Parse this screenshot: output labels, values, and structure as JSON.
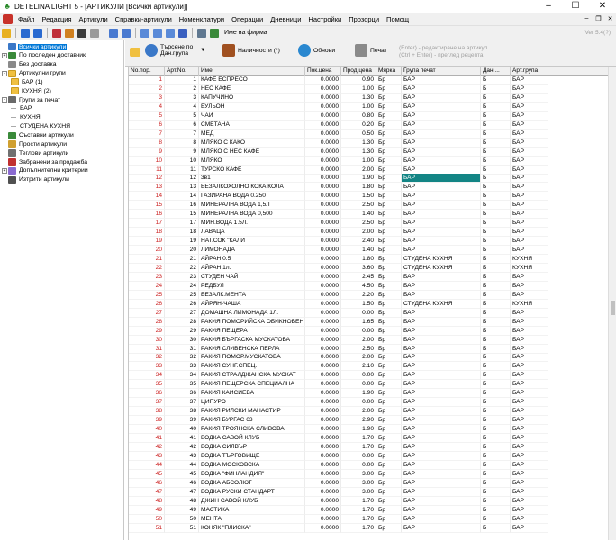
{
  "window": {
    "title": "DETELINA LIGHT 5 - [АРТИКУЛИ [Всички артикули]]"
  },
  "menu": [
    "Файл",
    "Редакция",
    "Артикули",
    "Справки-артикули",
    "Номенклатури",
    "Операции",
    "Дневници",
    "Настройки",
    "Прозорци",
    "Помощ"
  ],
  "toolbar": {
    "firm_label": "Име на фирма",
    "version": "Ver 5.4(?)"
  },
  "tree": [
    {
      "label": "Всички артикули",
      "level": 0,
      "selected": true,
      "icon": "articles-icon",
      "exp": ""
    },
    {
      "label": "По последен доставчик",
      "level": 0,
      "icon": "suppliers-icon",
      "exp": "+"
    },
    {
      "label": "Без доставка",
      "level": 0,
      "icon": "no-delivery-icon",
      "exp": ""
    },
    {
      "label": "Артикулни групи",
      "level": 0,
      "icon": "folder-icon",
      "exp": "-"
    },
    {
      "label": "БАР (1)",
      "level": 1,
      "icon": "folder-icon",
      "exp": ""
    },
    {
      "label": "КУХНЯ (2)",
      "level": 1,
      "icon": "folder-icon",
      "exp": ""
    },
    {
      "label": "Групи за печат",
      "level": 0,
      "icon": "print-groups-icon",
      "exp": "-"
    },
    {
      "label": "БАР",
      "level": 1,
      "icon": "",
      "exp": ""
    },
    {
      "label": "КУХНЯ",
      "level": 1,
      "icon": "",
      "exp": ""
    },
    {
      "label": "СТУДЕНА КУХНЯ",
      "level": 1,
      "icon": "",
      "exp": ""
    },
    {
      "label": "Съставни артикули",
      "level": 0,
      "icon": "composite-icon",
      "exp": ""
    },
    {
      "label": "Прости артикули",
      "level": 0,
      "icon": "simple-icon",
      "exp": ""
    },
    {
      "label": "Теглови артикули",
      "level": 0,
      "icon": "weight-icon",
      "exp": ""
    },
    {
      "label": "Забранени за продажба",
      "level": 0,
      "icon": "forbidden-icon",
      "exp": ""
    },
    {
      "label": "Допълнителни критерии",
      "level": 0,
      "icon": "criteria-icon",
      "exp": "+"
    },
    {
      "label": "Изтрити артикули",
      "level": 0,
      "icon": "trash-icon",
      "exp": ""
    }
  ],
  "actions": {
    "search_group": "Търсене по\nДан.група",
    "availability": "Наличности (*)",
    "refresh": "Обнови",
    "print": "Печат",
    "hint": "(Enter) - редактиране на артикул\n(Ctrl + Enter) - преглед рецепта"
  },
  "columns": [
    "No.пор.",
    "Арт.No.",
    "Име",
    "Пок.цена",
    "Прод.цена",
    "Мярка",
    "Група печат",
    "Дан....",
    "Арт.група"
  ],
  "rows": [
    [
      "1",
      "1",
      "КАФЕ ЕСПРЕСО",
      "0.0000",
      "0.90",
      "Бр",
      "БАР",
      "Б",
      "БАР"
    ],
    [
      "2",
      "2",
      "НЕС КАФЕ",
      "0.0000",
      "1.00",
      "Бр",
      "БАР",
      "Б",
      "БАР"
    ],
    [
      "3",
      "3",
      "КАПУЧИНО",
      "0.0000",
      "1.30",
      "Бр",
      "БАР",
      "Б",
      "БАР"
    ],
    [
      "4",
      "4",
      "БУЛЬОН",
      "0.0000",
      "1.00",
      "Бр",
      "БАР",
      "Б",
      "БАР"
    ],
    [
      "5",
      "5",
      "ЧАЙ",
      "0.0000",
      "0.80",
      "Бр",
      "БАР",
      "Б",
      "БАР"
    ],
    [
      "6",
      "6",
      "СМЕТАНА",
      "0.0000",
      "0.20",
      "Бр",
      "БАР",
      "Б",
      "БАР"
    ],
    [
      "7",
      "7",
      "МЕД",
      "0.0000",
      "0.50",
      "Бр",
      "БАР",
      "Б",
      "БАР"
    ],
    [
      "8",
      "8",
      "МЛЯКО С КАКО",
      "0.0000",
      "1.30",
      "Бр",
      "БАР",
      "Б",
      "БАР"
    ],
    [
      "9",
      "9",
      "МЛЯКО С НЕС КАФЕ",
      "0.0000",
      "1.30",
      "Бр",
      "БАР",
      "Б",
      "БАР"
    ],
    [
      "10",
      "10",
      "МЛЯКО",
      "0.0000",
      "1.00",
      "Бр",
      "БАР",
      "Б",
      "БАР"
    ],
    [
      "11",
      "11",
      "ТУРСКО КАФЕ",
      "0.0000",
      "2.00",
      "Бр",
      "БАР",
      "Б",
      "БАР"
    ],
    [
      "12",
      "12",
      "3в1",
      "0.0000",
      "1.90",
      "Бр",
      "БАР",
      "Б",
      "БАР"
    ],
    [
      "13",
      "13",
      "БЕЗАЛКОХОЛНО КОКА КОЛА",
      "0.0000",
      "1.80",
      "Бр",
      "БАР",
      "Б",
      "БАР"
    ],
    [
      "14",
      "14",
      "ГАЗИРАНА ВОДА 0.250",
      "0.0000",
      "1.50",
      "Бр",
      "БАР",
      "Б",
      "БАР"
    ],
    [
      "15",
      "16",
      "МИНЕРАЛНА ВОДА 1,5Л",
      "0.0000",
      "2.50",
      "Бр",
      "БАР",
      "Б",
      "БАР"
    ],
    [
      "16",
      "15",
      "МИНЕРАЛНА ВОДА 0,500",
      "0.0000",
      "1.40",
      "Бр",
      "БАР",
      "Б",
      "БАР"
    ],
    [
      "17",
      "17",
      "МИН.ВОДА 1.5Л.",
      "0.0000",
      "2.50",
      "Бр",
      "БАР",
      "Б",
      "БАР"
    ],
    [
      "18",
      "18",
      "ЛАВАЦА",
      "0.0000",
      "2.00",
      "Бр",
      "БАР",
      "Б",
      "БАР"
    ],
    [
      "19",
      "19",
      "НАТ.СОК \"КАЛИ",
      "0.0000",
      "2.40",
      "Бр",
      "БАР",
      "Б",
      "БАР"
    ],
    [
      "20",
      "20",
      "ЛИМОНАДА",
      "0.0000",
      "1.40",
      "Бр",
      "БАР",
      "Б",
      "БАР"
    ],
    [
      "21",
      "21",
      "АЙРАН 0.5",
      "0.0000",
      "1.80",
      "Бр",
      "СТУДЕНА КУХНЯ",
      "Б",
      "КУХНЯ"
    ],
    [
      "22",
      "22",
      "АЙРАН 1л.",
      "0.0000",
      "3.60",
      "Бр",
      "СТУДЕНА КУХНЯ",
      "Б",
      "КУХНЯ"
    ],
    [
      "23",
      "23",
      "СТУДЕН ЧАЙ",
      "0.0000",
      "2.45",
      "Бр",
      "БАР",
      "Б",
      "БАР"
    ],
    [
      "24",
      "24",
      "РЕДБУЛ",
      "0.0000",
      "4.50",
      "Бр",
      "БАР",
      "Б",
      "БАР"
    ],
    [
      "25",
      "25",
      "БЕЗАЛК.МЕНТА",
      "0.0000",
      "2.20",
      "Бр",
      "БАР",
      "Б",
      "БАР"
    ],
    [
      "26",
      "26",
      "АЙРЯН-ЧАША",
      "0.0000",
      "1.50",
      "Бр",
      "СТУДЕНА КУХНЯ",
      "Б",
      "КУХНЯ"
    ],
    [
      "27",
      "27",
      "ДОМАШНА ЛИМОНАДА 1Л.",
      "0.0000",
      "0.00",
      "Бр",
      "БАР",
      "Б",
      "БАР"
    ],
    [
      "28",
      "28",
      "РАКИЯ ПОМОРИЙСКА ОБИКНОВЕН",
      "0.0000",
      "1.65",
      "Бр",
      "БАР",
      "Б",
      "БАР"
    ],
    [
      "29",
      "29",
      "РАКИЯ ПЕЩЕРА",
      "0.0000",
      "0.00",
      "Бр",
      "БАР",
      "Б",
      "БАР"
    ],
    [
      "30",
      "30",
      "РАКИЯ БЪРГАСКА МУСКАТОВА",
      "0.0000",
      "2.00",
      "Бр",
      "БАР",
      "Б",
      "БАР"
    ],
    [
      "31",
      "31",
      "РАКИЯ СЛИВЕНСКА ПЕРЛА",
      "0.0000",
      "2.50",
      "Бр",
      "БАР",
      "Б",
      "БАР"
    ],
    [
      "32",
      "32",
      "РАКИЯ ПОМОР.МУСКАТОВА",
      "0.0000",
      "2.00",
      "Бр",
      "БАР",
      "Б",
      "БАР"
    ],
    [
      "33",
      "33",
      "РАКИЯ СУНГ.СПЕЦ.",
      "0.0000",
      "2.10",
      "Бр",
      "БАР",
      "Б",
      "БАР"
    ],
    [
      "34",
      "34",
      "РАКИЯ СТРАЛДЖАНСКА МУСКАТ",
      "0.0000",
      "0.00",
      "Бр",
      "БАР",
      "Б",
      "БАР"
    ],
    [
      "35",
      "35",
      "РАКИЯ ПЕЩЕРСКА СПЕЦИАЛНА",
      "0.0000",
      "0.00",
      "Бр",
      "БАР",
      "Б",
      "БАР"
    ],
    [
      "36",
      "36",
      "РАКИЯ КАИСИЕВА",
      "0.0000",
      "1.90",
      "Бр",
      "БАР",
      "Б",
      "БАР"
    ],
    [
      "37",
      "37",
      "ЦИПУРО",
      "0.0000",
      "0.00",
      "Бр",
      "БАР",
      "Б",
      "БАР"
    ],
    [
      "38",
      "38",
      "РАКИЯ РИЛСКИ МАНАСТИР",
      "0.0000",
      "2.00",
      "Бр",
      "БАР",
      "Б",
      "БАР"
    ],
    [
      "39",
      "39",
      "РАКИЯ БУРГАС 63",
      "0.0000",
      "2.90",
      "Бр",
      "БАР",
      "Б",
      "БАР"
    ],
    [
      "40",
      "40",
      "РАКИЯ ТРОЯНСКА СЛИВОВА",
      "0.0000",
      "1.90",
      "Бр",
      "БАР",
      "Б",
      "БАР"
    ],
    [
      "41",
      "41",
      "ВОДКА САВОЙ КЛУБ",
      "0.0000",
      "1.70",
      "Бр",
      "БАР",
      "Б",
      "БАР"
    ],
    [
      "42",
      "42",
      "ВОДКА СИЛВЪР",
      "0.0000",
      "1.70",
      "Бр",
      "БАР",
      "Б",
      "БАР"
    ],
    [
      "43",
      "43",
      "ВОДКА ТЪРГОВИЩЕ",
      "0.0000",
      "0.00",
      "Бр",
      "БАР",
      "Б",
      "БАР"
    ],
    [
      "44",
      "44",
      "ВОДКА МОСКОВСКА",
      "0.0000",
      "0.00",
      "Бр",
      "БАР",
      "Б",
      "БАР"
    ],
    [
      "45",
      "45",
      "ВОДКА \"ФИНЛАНДИЯ\"",
      "0.0000",
      "3.00",
      "Бр",
      "БАР",
      "Б",
      "БАР"
    ],
    [
      "46",
      "46",
      "ВОДКА АБСОЛЮТ",
      "0.0000",
      "3.00",
      "Бр",
      "БАР",
      "Б",
      "БАР"
    ],
    [
      "47",
      "47",
      "ВОДКА РУСКИ СТАНДАРТ",
      "0.0000",
      "3.00",
      "Бр",
      "БАР",
      "Б",
      "БАР"
    ],
    [
      "48",
      "48",
      "ДЖИН САВОЙ КЛУБ",
      "0.0000",
      "1.70",
      "Бр",
      "БАР",
      "Б",
      "БАР"
    ],
    [
      "49",
      "49",
      "МАСТИКА",
      "0.0000",
      "1.70",
      "Бр",
      "БАР",
      "Б",
      "БАР"
    ],
    [
      "50",
      "50",
      "МЕНТА",
      "0.0000",
      "1.70",
      "Бр",
      "БАР",
      "Б",
      "БАР"
    ],
    [
      "51",
      "51",
      "КОНЯК \"ПЛИСКА\"",
      "0.0000",
      "1.70",
      "Бр",
      "БАР",
      "Б",
      "БАР"
    ]
  ],
  "highlight": {
    "row": 11,
    "col": 6
  }
}
